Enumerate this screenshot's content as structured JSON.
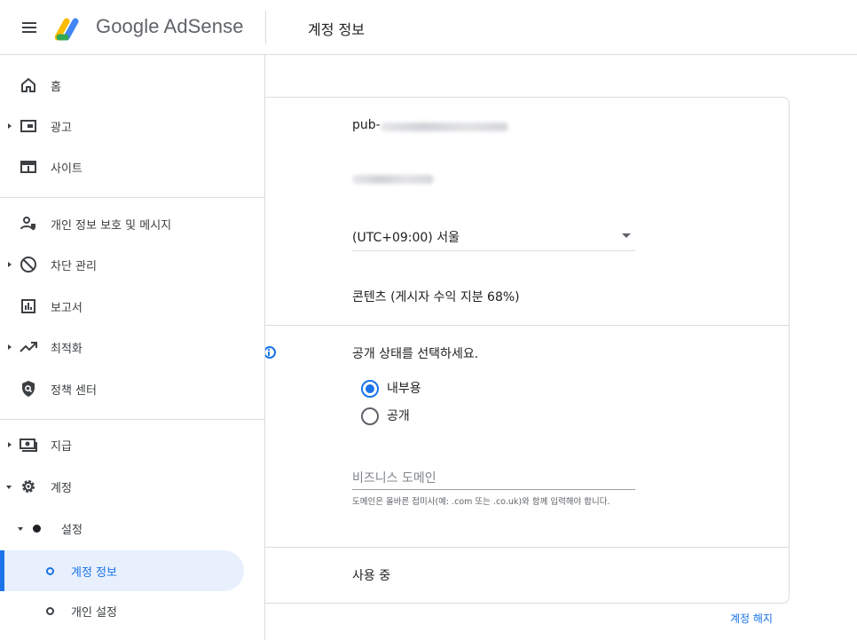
{
  "header": {
    "menu_icon": "hamburger-menu-icon",
    "logo_icon": "adsense-logo-icon",
    "logo_text": "Google AdSense",
    "page_title": "계정 정보"
  },
  "sidebar": {
    "items": [
      {
        "label": "홈",
        "icon": "home-icon"
      },
      {
        "label": "광고",
        "icon": "ads-icon"
      },
      {
        "label": "사이트",
        "icon": "sites-icon"
      },
      {
        "label": "개인 정보 보호 및 메시지",
        "icon": "privacy-icon"
      },
      {
        "label": "차단 관리",
        "icon": "block-icon"
      },
      {
        "label": "보고서",
        "icon": "reports-icon"
      },
      {
        "label": "최적화",
        "icon": "trending-icon"
      },
      {
        "label": "정책 센터",
        "icon": "policy-shield-icon"
      },
      {
        "label": "지급",
        "icon": "payments-icon"
      },
      {
        "label": "계정",
        "icon": "gear-icon"
      },
      {
        "label": "설정",
        "icon": "dot-filled-icon"
      },
      {
        "label": "계정 정보",
        "icon": "dot-ring-icon"
      },
      {
        "label": "개인 설정",
        "icon": "dot-ring-icon"
      }
    ],
    "active_item": "계정 정보",
    "accent_color": "#1a73e8",
    "active_bg": "#e8f0fe"
  },
  "account": {
    "publisher_prefix": "pub-",
    "timezone": "(UTC+09:00) 서울",
    "product": "콘텐츠 (게시자 수익 지분 68%)",
    "visibility_prompt": "공개 상태를 선택하세요.",
    "visibility_options": [
      "내부용",
      "공개"
    ],
    "visibility_selected": "내부용",
    "business_domain_placeholder": "비즈니스 도메인",
    "business_domain_helper": "도메인은 올바른 접미사(예: .com 또는 .co.uk)와 함께 입력해야 합니다.",
    "status": "사용 중",
    "close_account": "계정 해지"
  }
}
